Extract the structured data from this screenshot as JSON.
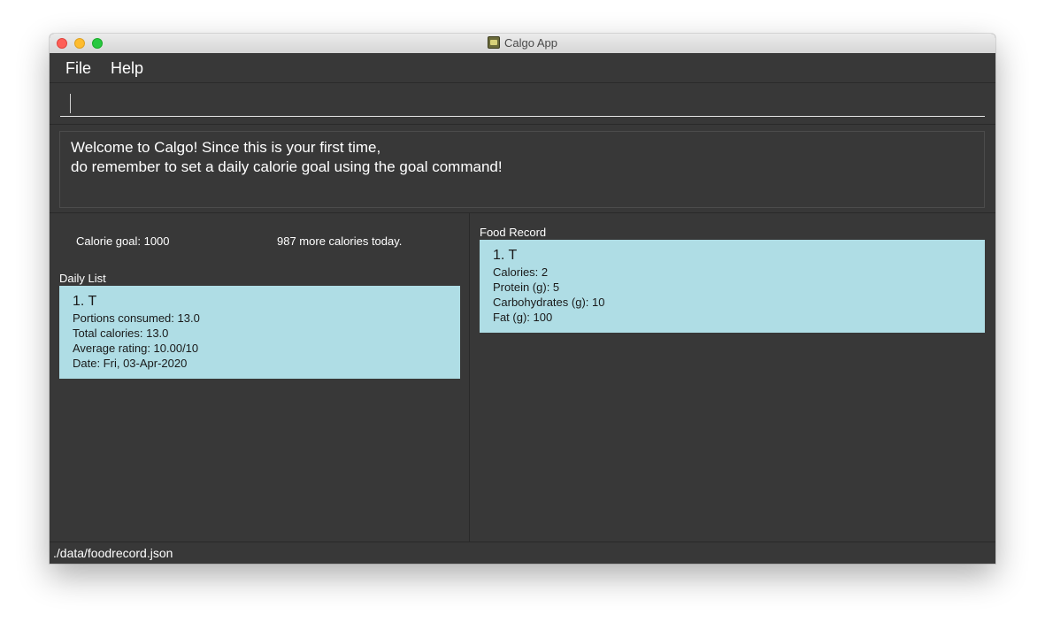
{
  "window": {
    "title": "Calgo App"
  },
  "menu": {
    "items": [
      "File",
      "Help"
    ]
  },
  "command_box": {
    "value": "",
    "placeholder": ""
  },
  "result_display": {
    "message": "Welcome to Calgo! Since this is your first time,\ndo remember to set a daily calorie goal using the goal command!"
  },
  "daily_panel": {
    "calorie_goal": "Calorie goal: 1000",
    "remaining": "987 more calories today.",
    "list_label": "Daily List",
    "entries": [
      {
        "header": "1.  T",
        "lines": [
          "Portions consumed: 13.0",
          "Total calories: 13.0",
          "Average rating: 10.00/10",
          "Date: Fri, 03-Apr-2020"
        ]
      }
    ]
  },
  "food_panel": {
    "list_label": "Food Record",
    "entries": [
      {
        "header": "1.  T",
        "lines": [
          "Calories: 2",
          "Protein (g): 5",
          "Carbohydrates (g): 10",
          "Fat (g): 100"
        ]
      }
    ]
  },
  "status_bar": {
    "path": "./data/foodrecord.json"
  },
  "colors": {
    "window_bg": "#383838",
    "card_bg": "#afdde5",
    "text": "#ffffff"
  }
}
